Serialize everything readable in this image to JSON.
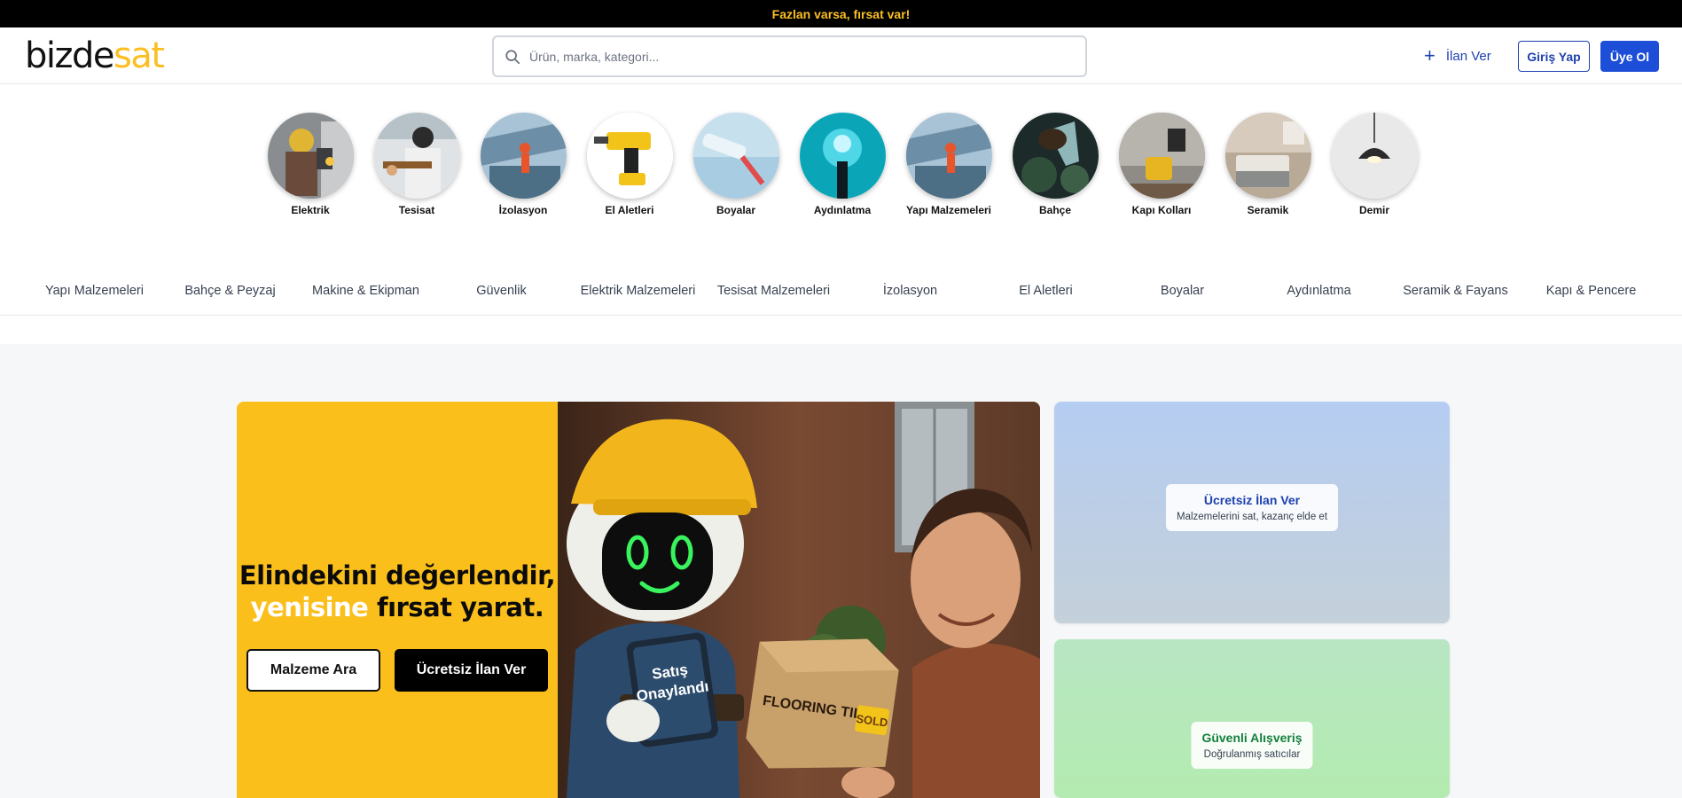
{
  "topbar": {
    "text": "Fazlan varsa, fırsat var!"
  },
  "header": {
    "logo_part1": "bizde",
    "logo_part2": "sat",
    "search_placeholder": "Ürün, marka, kategori...",
    "post_ad_label": "İlan Ver",
    "login_label": "Giriş Yap",
    "signup_label": "Üye Ol"
  },
  "category_circles": [
    {
      "label": "Elektrik",
      "icon": "electrician-photo"
    },
    {
      "label": "Tesisat",
      "icon": "plumber-photo"
    },
    {
      "label": "İzolasyon",
      "icon": "insulation-photo"
    },
    {
      "label": "El Aletleri",
      "icon": "drill-photo"
    },
    {
      "label": "Boyalar",
      "icon": "paint-roller-photo"
    },
    {
      "label": "Aydınlatma",
      "icon": "lighting-photo"
    },
    {
      "label": "Yapı Malzemeleri",
      "icon": "building-materials-photo"
    },
    {
      "label": "Bahçe",
      "icon": "garden-photo"
    },
    {
      "label": "Kapı Kolları",
      "icon": "door-handle-photo"
    },
    {
      "label": "Seramik",
      "icon": "ceramic-photo"
    },
    {
      "label": "Demir",
      "icon": "pendant-lamp-photo"
    }
  ],
  "category_nav": [
    "Yapı Malzemeleri",
    "Bahçe & Peyzaj",
    "Makine & Ekipman",
    "Güvenlik",
    "Elektrik Malzemeleri",
    "Tesisat Malzemeleri",
    "İzolasyon",
    "El Aletleri",
    "Boyalar",
    "Aydınlatma",
    "Seramik & Fayans",
    "Kapı & Pencere"
  ],
  "hero": {
    "headline_line1": "Elindekini değerlendir,",
    "headline_white": "yenisine",
    "headline_rest": "fırsat yarat.",
    "button_search": "Malzeme Ara",
    "button_post": "Ücretsiz İlan Ver",
    "tablet_line1": "Satış",
    "tablet_line2": "Onaylandı",
    "box_text": "FLOORING TILES",
    "box_sticker": "SOLD"
  },
  "side_cards": {
    "card1_title": "Ücretsiz İlan Ver",
    "card1_subtitle": "Malzemelerini sat, kazanç elde et",
    "card2_title": "Güvenli Alışveriş",
    "card2_subtitle": "Doğrulanmış satıcılar"
  },
  "colors": {
    "brand_yellow": "#fbbf24",
    "brand_blue": "#1d4ed8",
    "hero_yellow": "#fbbf1c"
  }
}
